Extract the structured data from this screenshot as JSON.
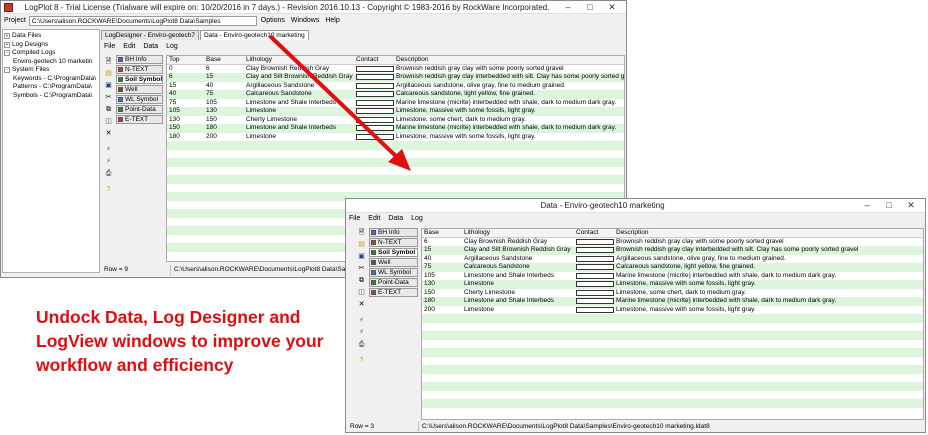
{
  "main_window": {
    "title": "LogPlot 8 - Trial License (Trialware will expire on: 10/20/2016  in 7 days.) - Revision 2016.10.13 - Copyright © 1983-2016 by RockWare Incorporated.",
    "project_label": "Project",
    "project_path": "C:\\Users\\alison.ROCKWARE\\Documents\\LogPlot8 Data\\Samples",
    "top_menu": [
      "Options",
      "Windows",
      "Help"
    ],
    "tree": [
      {
        "label": "Data Files",
        "level": 0,
        "box": "+"
      },
      {
        "label": "Log Designs",
        "level": 0,
        "box": "+"
      },
      {
        "label": "Compiled Logs",
        "level": 0,
        "box": "-"
      },
      {
        "label": "Enviro-geotech 10 marketin",
        "level": 1,
        "box": ""
      },
      {
        "label": "System Files",
        "level": 0,
        "box": "-"
      },
      {
        "label": "Keywords - C:\\ProgramData\\",
        "level": 1,
        "box": ""
      },
      {
        "label": "Patterns - C:\\ProgramData\\",
        "level": 1,
        "box": ""
      },
      {
        "label": "Symbols - C:\\ProgramData\\",
        "level": 1,
        "box": ""
      }
    ],
    "tabs": [
      "LogDesigner - Enviro-geotech7",
      "Data - Enviro-geotech10 marketing"
    ],
    "inner_menu": [
      "File",
      "Edit",
      "Data",
      "Log"
    ],
    "status_row": "Row = 9",
    "status_path": "C:\\Users\\alison.ROCKWARE\\Documents\\LogPlot8 Data\\Samples\\Enviro"
  },
  "side_tabs": [
    {
      "label": "BH Info",
      "marker": "#3a6fc9"
    },
    {
      "label": "N-TEXT",
      "marker": "#c0392b"
    },
    {
      "label": "Soil Symbol",
      "marker": "#2a8a2a"
    },
    {
      "label": "Well",
      "marker": "#7a4a1a"
    },
    {
      "label": "WL Symbol",
      "marker": "#3a6fc9"
    },
    {
      "label": "Point-Data",
      "marker": "#2a8a2a"
    },
    {
      "label": "E-TEXT",
      "marker": "#c0392b"
    }
  ],
  "grid_headers": [
    "Top",
    "Base",
    "Lithology",
    "Contact",
    "Description"
  ],
  "rows": [
    {
      "top": "0",
      "base": "6",
      "lith": "Clay Brownish Reddish Gray",
      "desc": "Brownish reddish gray clay with some poorly sorted gravel"
    },
    {
      "top": "6",
      "base": "15",
      "lith": "Clay and Silt Brownish Reddish Gray",
      "desc": "Brownish reddish gray clay interbedded with silt. Clay has some poorly sorted gravel"
    },
    {
      "top": "15",
      "base": "40",
      "lith": "Argillaceous Sandstone",
      "desc": "Argillaceous sandstone, olive gray, fine to medium grained."
    },
    {
      "top": "40",
      "base": "75",
      "lith": "Calcareous Sandstone",
      "desc": "Calcareous sandstone, light yellow, fine grained."
    },
    {
      "top": "75",
      "base": "105",
      "lith": "Limestone and Shale Interbeds",
      "desc": "Marine limestone (micrite) interbedded with shale, dark to medium dark gray."
    },
    {
      "top": "105",
      "base": "130",
      "lith": "Limestone",
      "desc": "Limestone, massive with some fossils, light gray."
    },
    {
      "top": "130",
      "base": "150",
      "lith": "Cherty Limestone",
      "desc": "Limestone, some chert, dark to medium gray."
    },
    {
      "top": "150",
      "base": "180",
      "lith": "Limestone and Shale Interbeds",
      "desc": "Marine limestone (micrite) interbedded with shale, dark to medium dark gray."
    },
    {
      "top": "180",
      "base": "200",
      "lith": "Limestone",
      "desc": "Limestone, massive with some fossils, light gray."
    }
  ],
  "undocked_window": {
    "title": "Data - Enviro-geotech10 marketing",
    "menu": [
      "File",
      "Edit",
      "Data",
      "Log"
    ],
    "headers": [
      "Base",
      "Lithology",
      "Contact",
      "Description"
    ],
    "status_row": "Row = 3",
    "status_path": "C:\\Users\\alison.ROCKWARE\\Documents\\LogPlot8 Data\\Samples\\Enviro-geotech10 marketing.ldat8"
  },
  "promo_text": "Undock Data, Log Designer and LogView windows to improve your workflow and efficiency",
  "colors": {
    "promo": "#e20e0e",
    "row_green": "#ddf5dd",
    "arrow": "#e01010"
  },
  "icons": [
    "app-icon",
    "new-file-icon",
    "open-folder-icon",
    "save-icon",
    "cut-icon",
    "copy-icon",
    "paste-icon",
    "delete-icon",
    "calculate-icon",
    "fill-down-icon",
    "print-icon",
    "help-icon"
  ]
}
